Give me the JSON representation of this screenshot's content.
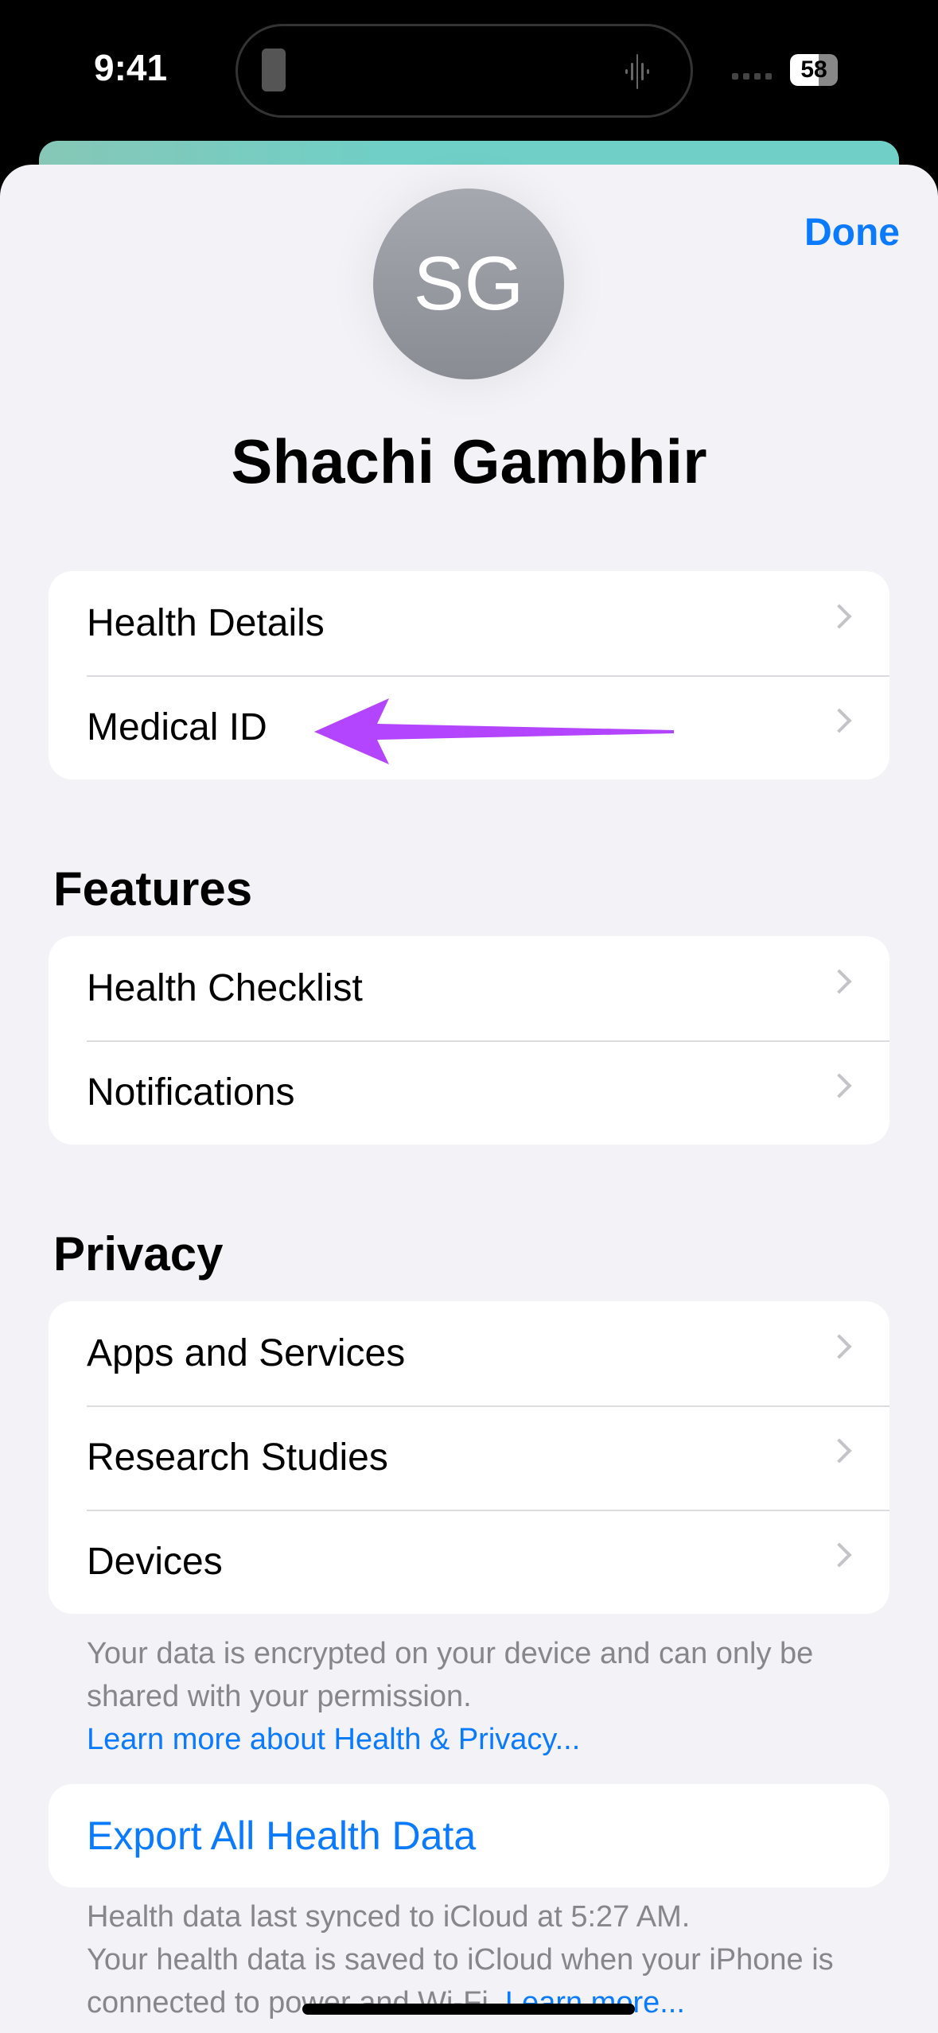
{
  "status_bar": {
    "time": "9:41",
    "battery": "58"
  },
  "header": {
    "done_label": "Done",
    "avatar_initials": "SG",
    "user_name": "Shachi Gambhir"
  },
  "account": {
    "items": [
      {
        "label": "Health Details"
      },
      {
        "label": "Medical ID"
      }
    ]
  },
  "features": {
    "title": "Features",
    "items": [
      {
        "label": "Health Checklist"
      },
      {
        "label": "Notifications"
      }
    ]
  },
  "privacy": {
    "title": "Privacy",
    "items": [
      {
        "label": "Apps and Services"
      },
      {
        "label": "Research Studies"
      },
      {
        "label": "Devices"
      }
    ],
    "footer": "Your data is encrypted on your device and can only be shared with your permission.",
    "learn_more": "Learn more about Health & Privacy..."
  },
  "export": {
    "label": "Export All Health Data",
    "footer_line1": "Health data last synced to iCloud at 5:27 AM.",
    "footer_line2": "Your health data is saved to iCloud when your iPhone is connected to power and Wi-Fi.",
    "learn_more": "Learn more..."
  },
  "annotation": {
    "color": "#b344ff",
    "points_to": "Medical ID"
  },
  "colors": {
    "accent": "#0a7aff",
    "background": "#f2f2f7"
  }
}
